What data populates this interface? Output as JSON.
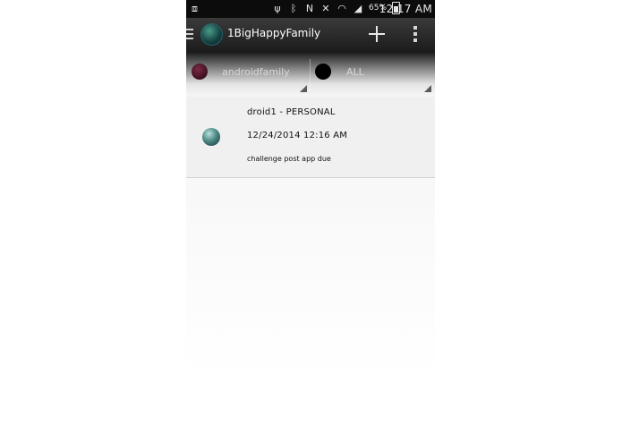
{
  "status_bar": {
    "battery_percent": "65%",
    "time": "12:17 AM",
    "icons": [
      "screen-cast-icon",
      "usb-icon",
      "bluetooth-icon",
      "nfc-icon",
      "mute-icon",
      "wifi-icon",
      "signal-icon",
      "battery-icon"
    ]
  },
  "action_bar": {
    "title": "1BigHappyFamily",
    "icons": [
      "drawer-menu-icon",
      "app-logo",
      "add-icon",
      "overflow-menu-icon"
    ]
  },
  "filters": {
    "family": {
      "label": "androidfamily",
      "color": "#5e1f36"
    },
    "category": {
      "label": "ALL",
      "color": "#000000"
    }
  },
  "items": [
    {
      "title": "droid1 - PERSONAL",
      "datetime": "12/24/2014 12:16 AM",
      "note": "challenge post app due",
      "avatar_color": "#4d8a86"
    }
  ]
}
